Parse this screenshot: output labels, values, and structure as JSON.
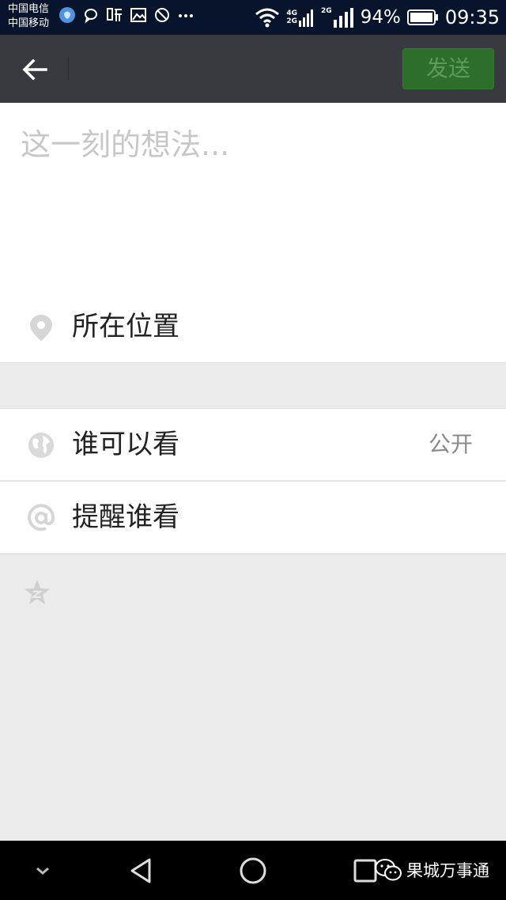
{
  "status_bar": {
    "carrier_1": "中国电信",
    "carrier_2": "中国移动",
    "network_top": "4G",
    "network_bottom": "2G",
    "network_2": "2G",
    "battery_level": "94%",
    "time": "09:35",
    "app_icons": [
      "bubble-app-icon",
      "chat-bubble-icon",
      "listen-app-icon",
      "image-icon",
      "no-disturb-icon",
      "more-dots-icon"
    ]
  },
  "header": {
    "back_icon": "arrow-left-icon",
    "send_label": "发送"
  },
  "compose": {
    "placeholder": "这一刻的想法...",
    "value": ""
  },
  "options": {
    "location_label": "所在位置",
    "visibility_label": "谁可以看",
    "visibility_value": "公开",
    "mention_label": "提醒谁看"
  },
  "share": {
    "qzone_icon": "qzone-star-icon"
  },
  "navbar": {
    "buttons": [
      "collapse-chevron-icon",
      "back-triangle-icon",
      "home-circle-icon",
      "recents-square-icon"
    ]
  },
  "watermark": {
    "text": "果城万事通"
  },
  "colors": {
    "header_bg": "#393a3f",
    "send_button_bg": "#2b6f2a",
    "page_bg": "#ebebeb",
    "status_bar_bg": "#07142b"
  }
}
